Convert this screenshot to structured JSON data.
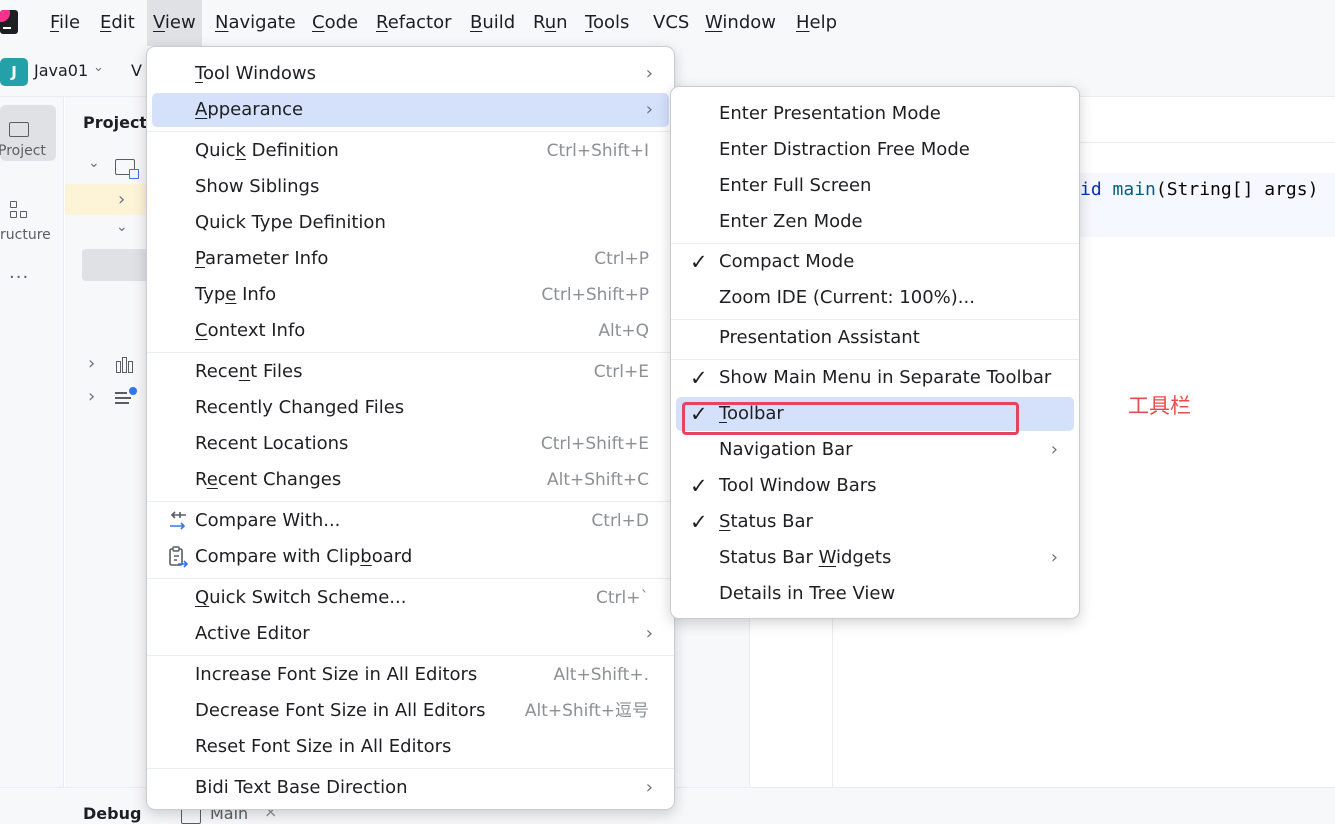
{
  "menubar": {
    "items": [
      {
        "label": "File",
        "mnemonic": 0
      },
      {
        "label": "Edit",
        "mnemonic": 0
      },
      {
        "label": "View",
        "mnemonic": 0
      },
      {
        "label": "Navigate",
        "mnemonic": 0
      },
      {
        "label": "Code",
        "mnemonic": 0
      },
      {
        "label": "Refactor",
        "mnemonic": 0
      },
      {
        "label": "Build",
        "mnemonic": 0
      },
      {
        "label": "Run",
        "mnemonic": 1
      },
      {
        "label": "Tools",
        "mnemonic": 0
      },
      {
        "label": "VCS",
        "mnemonic": -1
      },
      {
        "label": "Window",
        "mnemonic": 0
      },
      {
        "label": "Help",
        "mnemonic": 0
      }
    ],
    "active": "View"
  },
  "toolbar": {
    "project_badge": "J",
    "project_name": "Java01",
    "vcs_label": "V"
  },
  "tool_stripe": {
    "project_label": "Project",
    "structure_label": "ructure",
    "more": "···"
  },
  "project_panel": {
    "title": "Project"
  },
  "editor": {
    "code_line": {
      "pre": "id ",
      "fn": "main",
      "post": "(String[] args)"
    }
  },
  "annotation": "工具栏",
  "bottom_bar": {
    "debug_title": "Debug",
    "tab_label": "Main",
    "tab_close": "×"
  },
  "view_menu": {
    "items": [
      {
        "type": "item",
        "label": "Tool Windows",
        "mnemonic": 0,
        "submenu": true
      },
      {
        "type": "item",
        "label": "Appearance",
        "mnemonic": 0,
        "submenu": true,
        "highlight": true
      },
      {
        "type": "sep"
      },
      {
        "type": "item",
        "label": "Quick Definition",
        "mnemonic": 4,
        "shortcut": "Ctrl+Shift+I"
      },
      {
        "type": "item",
        "label": "Show Siblings",
        "mnemonic": -1
      },
      {
        "type": "item",
        "label": "Quick Type Definition",
        "mnemonic": -1
      },
      {
        "type": "item",
        "label": "Parameter Info",
        "mnemonic": 0,
        "shortcut": "Ctrl+P"
      },
      {
        "type": "item",
        "label": "Type Info",
        "mnemonic": 3,
        "shortcut": "Ctrl+Shift+P"
      },
      {
        "type": "item",
        "label": "Context Info",
        "mnemonic": 0,
        "shortcut": "Alt+Q"
      },
      {
        "type": "sep"
      },
      {
        "type": "item",
        "label": "Recent Files",
        "mnemonic": 4,
        "shortcut": "Ctrl+E"
      },
      {
        "type": "item",
        "label": "Recently Changed Files",
        "mnemonic": -1
      },
      {
        "type": "item",
        "label": "Recent Locations",
        "mnemonic": -1,
        "shortcut": "Ctrl+Shift+E"
      },
      {
        "type": "item",
        "label": "Recent Changes",
        "mnemonic": 1,
        "shortcut": "Alt+Shift+C"
      },
      {
        "type": "sep"
      },
      {
        "type": "item",
        "label": "Compare With...",
        "mnemonic": -1,
        "shortcut": "Ctrl+D",
        "icon": "compare-arrows-icon"
      },
      {
        "type": "item",
        "label": "Compare with Clipboard",
        "mnemonic": 17,
        "icon": "clipboard-compare-icon"
      },
      {
        "type": "sep"
      },
      {
        "type": "item",
        "label": "Quick Switch Scheme...",
        "mnemonic": 0,
        "shortcut": "Ctrl+`"
      },
      {
        "type": "item",
        "label": "Active Editor",
        "mnemonic": -1,
        "submenu": true
      },
      {
        "type": "sep"
      },
      {
        "type": "item",
        "label": "Increase Font Size in All Editors",
        "mnemonic": -1,
        "shortcut": "Alt+Shift+."
      },
      {
        "type": "item",
        "label": "Decrease Font Size in All Editors",
        "mnemonic": -1,
        "shortcut": "Alt+Shift+逗号"
      },
      {
        "type": "item",
        "label": "Reset Font Size in All Editors",
        "mnemonic": -1
      },
      {
        "type": "sep"
      },
      {
        "type": "item",
        "label": "Bidi Text Base Direction",
        "mnemonic": -1,
        "submenu": true
      }
    ]
  },
  "appearance_menu": {
    "items": [
      {
        "type": "item",
        "label": "Enter Presentation Mode",
        "mnemonic": -1
      },
      {
        "type": "item",
        "label": "Enter Distraction Free Mode",
        "mnemonic": -1
      },
      {
        "type": "item",
        "label": "Enter Full Screen",
        "mnemonic": -1
      },
      {
        "type": "item",
        "label": "Enter Zen Mode",
        "mnemonic": -1
      },
      {
        "type": "sep"
      },
      {
        "type": "item",
        "label": "Compact Mode",
        "mnemonic": -1,
        "checked": true
      },
      {
        "type": "item",
        "label": "Zoom IDE (Current: 100%)...",
        "mnemonic": -1
      },
      {
        "type": "sep"
      },
      {
        "type": "item",
        "label": "Presentation Assistant",
        "mnemonic": -1
      },
      {
        "type": "sep"
      },
      {
        "type": "item",
        "label": "Show Main Menu in Separate Toolbar",
        "mnemonic": -1,
        "checked": true
      },
      {
        "type": "item",
        "label": "Toolbar",
        "mnemonic": 0,
        "checked": true,
        "highlight": true
      },
      {
        "type": "item",
        "label": "Navigation Bar",
        "mnemonic": -1,
        "submenu": true
      },
      {
        "type": "item",
        "label": "Tool Window Bars",
        "mnemonic": -1,
        "checked": true
      },
      {
        "type": "item",
        "label": "Status Bar",
        "mnemonic": 0,
        "checked": true
      },
      {
        "type": "item",
        "label": "Status Bar Widgets",
        "mnemonic": 11,
        "submenu": true
      },
      {
        "type": "item",
        "label": "Details in Tree View",
        "mnemonic": -1
      }
    ]
  },
  "icons": {
    "submenu_arrow": "›",
    "check": "✓",
    "tree_collapsed": "›",
    "tree_expanded": "⌄",
    "dropdown_chevron": "⌄"
  },
  "colors": {
    "highlight": "#d5e1fb",
    "annotation_red": "#e5445e",
    "project_badge": "#24a0a8"
  }
}
